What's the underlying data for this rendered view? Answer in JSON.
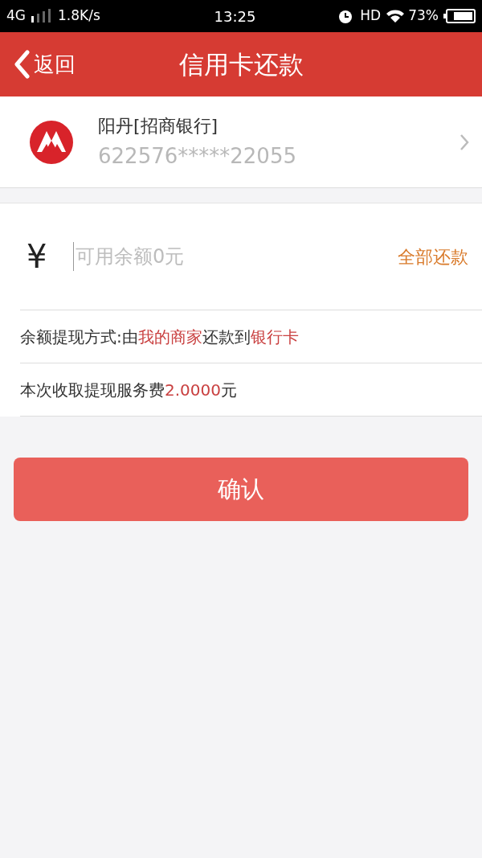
{
  "status_bar": {
    "network": "4G",
    "speed": "1.8K/s",
    "time": "13:25",
    "hd": "HD",
    "battery": "73%"
  },
  "header": {
    "back": "返回",
    "title": "信用卡还款"
  },
  "card": {
    "holder": "阳丹[招商银行]",
    "number": "622576*****22055"
  },
  "amount": {
    "currency": "¥",
    "placeholder": "可用余额0元",
    "action": "全部还款"
  },
  "info_rows": [
    {
      "parts": [
        {
          "text": "余额提现方式:由",
          "highlight": false
        },
        {
          "text": "我的商家",
          "highlight": true
        },
        {
          "text": "还款到",
          "highlight": false
        },
        {
          "text": "银行卡",
          "highlight": true
        }
      ]
    },
    {
      "parts": [
        {
          "text": "本次收取提现服务费",
          "highlight": false
        },
        {
          "text": "2.0000",
          "highlight": true
        },
        {
          "text": "元",
          "highlight": false
        }
      ]
    }
  ],
  "confirm": "确认"
}
